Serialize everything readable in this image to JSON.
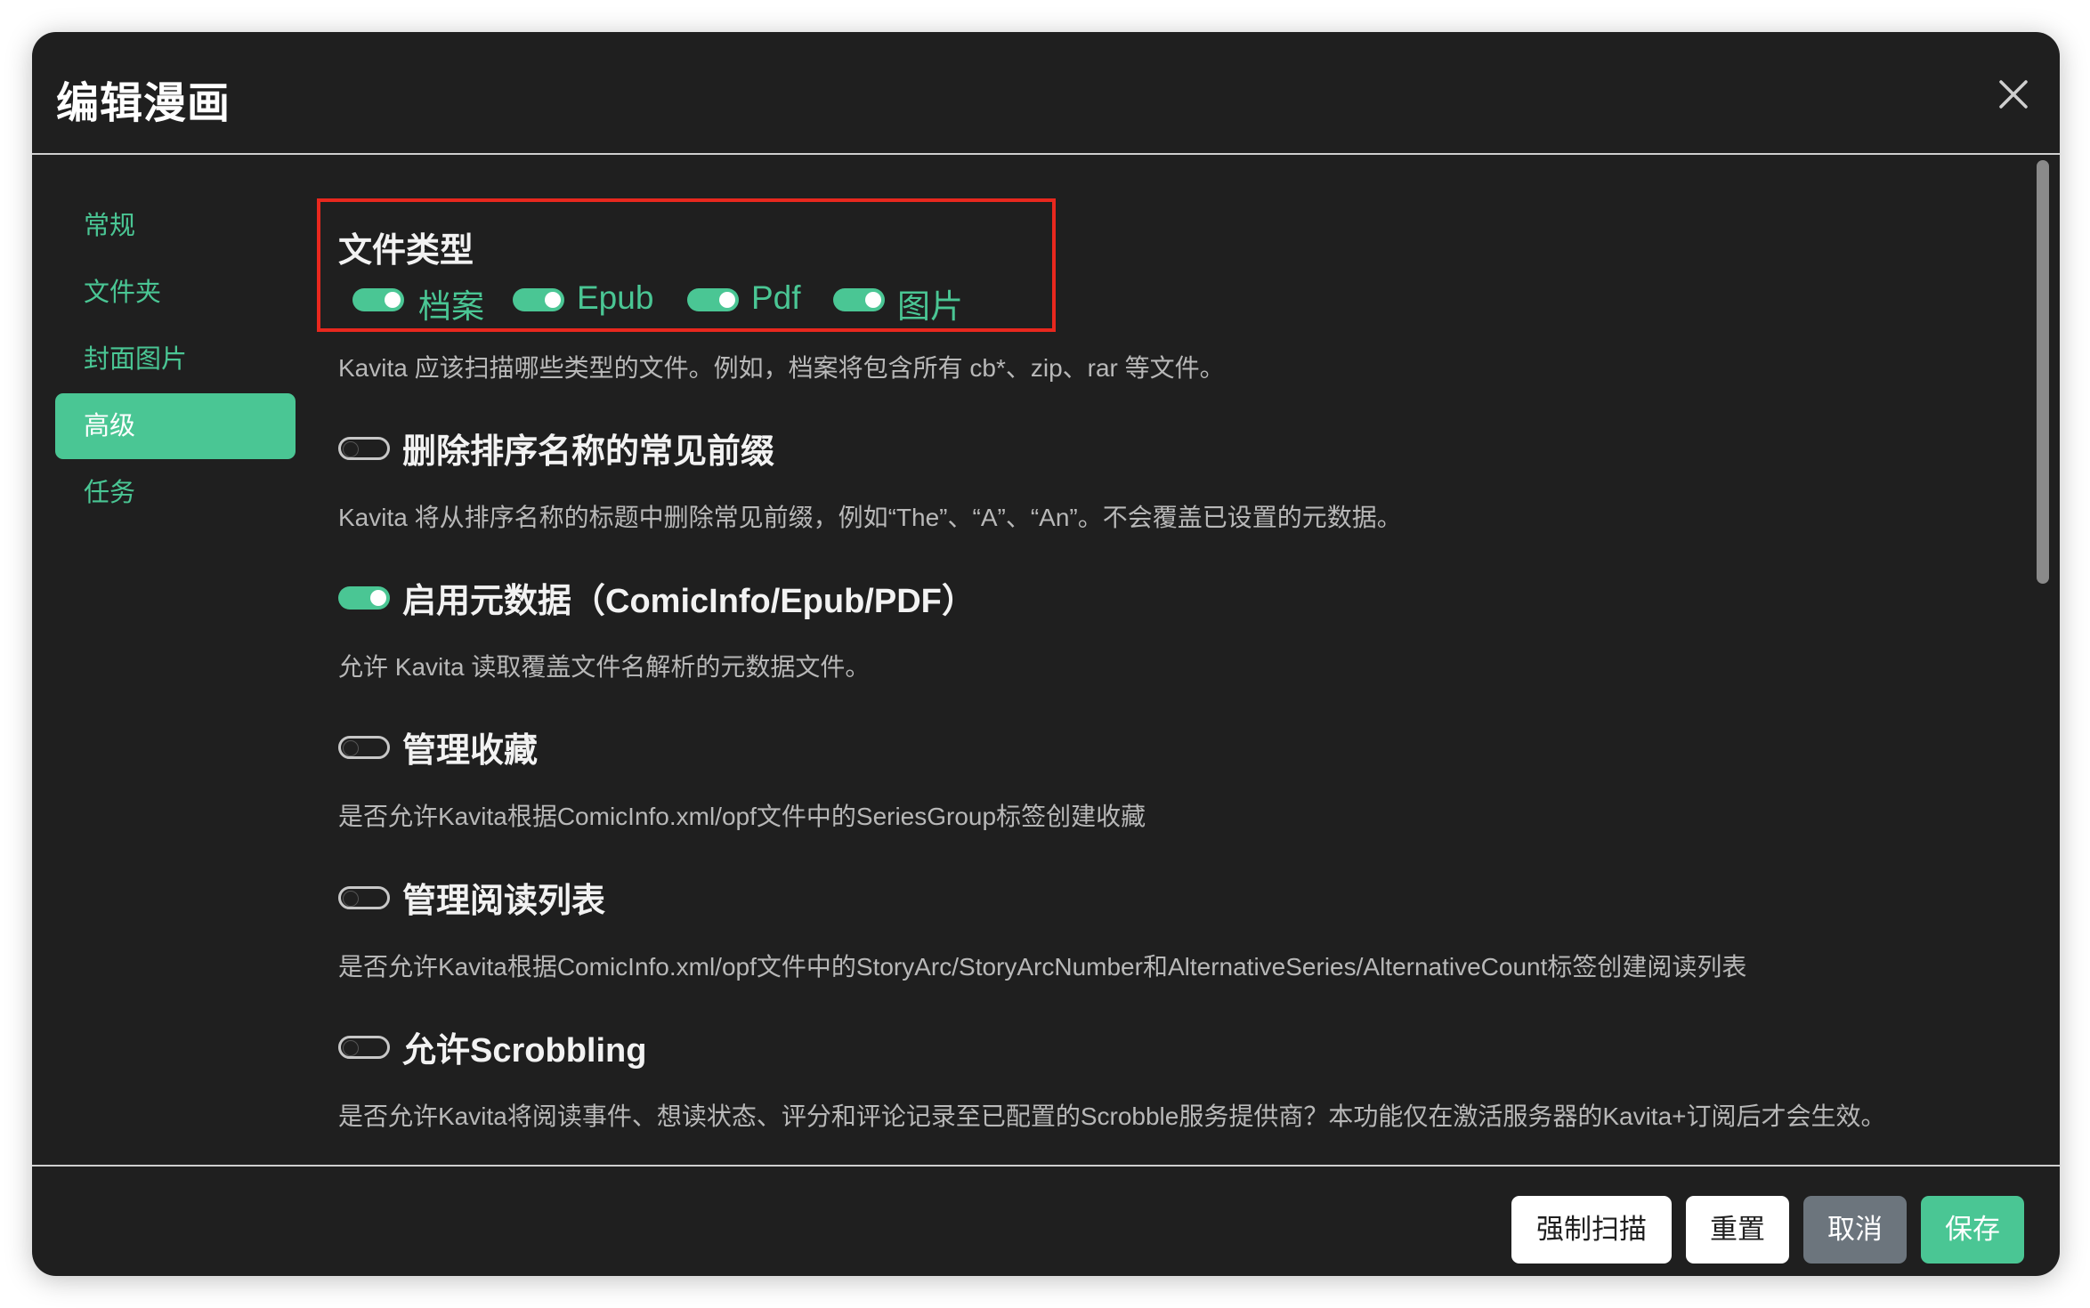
{
  "dialog": {
    "title": "编辑漫画"
  },
  "sidebar": {
    "items": [
      {
        "label": "常规"
      },
      {
        "label": "文件夹"
      },
      {
        "label": "封面图片"
      },
      {
        "label": "高级",
        "active": true
      },
      {
        "label": "任务"
      }
    ]
  },
  "file_types": {
    "title": "文件类型",
    "options": [
      {
        "label": "档案",
        "enabled": true
      },
      {
        "label": "Epub",
        "enabled": true
      },
      {
        "label": "Pdf",
        "enabled": true
      },
      {
        "label": "图片",
        "enabled": true
      }
    ],
    "description": "Kavita 应该扫描哪些类型的文件。例如，档案将包含所有 cb*、zip、rar 等文件。"
  },
  "settings": [
    {
      "label": "删除排序名称的常见前缀",
      "enabled": false,
      "description": "Kavita 将从排序名称的标题中删除常见前缀，例如“The”、“A”、“An”。不会覆盖已设置的元数据。"
    },
    {
      "label": "启用元数据（ComicInfo/Epub/PDF）",
      "enabled": true,
      "description": "允许 Kavita 读取覆盖文件名解析的元数据文件。"
    },
    {
      "label": "管理收藏",
      "enabled": false,
      "description": "是否允许Kavita根据ComicInfo.xml/opf文件中的SeriesGroup标签创建收藏"
    },
    {
      "label": "管理阅读列表",
      "enabled": false,
      "description": "是否允许Kavita根据ComicInfo.xml/opf文件中的StoryArc/StoryArcNumber和AlternativeSeries/AlternativeCount标签创建阅读列表"
    },
    {
      "label": "允许Scrobbling",
      "enabled": false,
      "description": "是否允许Kavita将阅读事件、想读状态、评分和评论记录至已配置的Scrobble服务提供商？本功能仅在激活服务器的Kavita+订阅后才会生效。"
    }
  ],
  "footer": {
    "force_scan": "强制扫描",
    "reset": "重置",
    "cancel": "取消",
    "save": "保存"
  },
  "colors": {
    "accent": "#4ac694",
    "background": "#1f1f1f",
    "highlight_border": "#e8281e"
  }
}
